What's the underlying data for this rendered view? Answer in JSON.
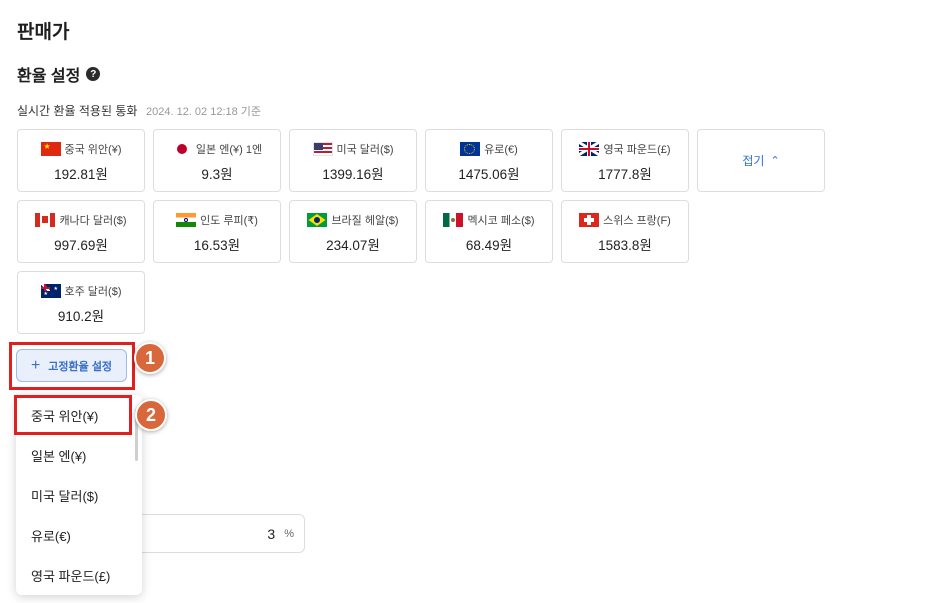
{
  "header": {
    "title": "판매가"
  },
  "exchange": {
    "title": "환율 설정",
    "help_icon": "question-circle-icon",
    "realtime_label": "실시간 환율 적용된 통화",
    "realtime_date": "2024. 12. 02 12:18 기준",
    "fold_label": "접기",
    "currencies": [
      {
        "label": "중국 위안(¥)",
        "value": "192.81원",
        "flag": "flag-china-icon"
      },
      {
        "label": "일본 엔(¥) 1엔",
        "value": "9.3원",
        "flag": "flag-japan-icon"
      },
      {
        "label": "미국 달러($)",
        "value": "1399.16원",
        "flag": "flag-usa-icon"
      },
      {
        "label": "유로(€)",
        "value": "1475.06원",
        "flag": "flag-eu-icon"
      },
      {
        "label": "영국 파운드(£)",
        "value": "1777.8원",
        "flag": "flag-uk-icon"
      },
      {
        "label": "캐나다 달러($)",
        "value": "997.69원",
        "flag": "flag-canada-icon"
      },
      {
        "label": "인도 루피(₹)",
        "value": "16.53원",
        "flag": "flag-india-icon"
      },
      {
        "label": "브라질 헤알($)",
        "value": "234.07원",
        "flag": "flag-brazil-icon"
      },
      {
        "label": "멕시코 페소($)",
        "value": "68.49원",
        "flag": "flag-mexico-icon"
      },
      {
        "label": "스위스 프랑(F)",
        "value": "1583.8원",
        "flag": "flag-switzerland-icon"
      },
      {
        "label": "호주 달러($)",
        "value": "910.2원",
        "flag": "flag-australia-icon"
      }
    ]
  },
  "fixed_rate": {
    "button_label": "고정환율 설정",
    "dropdown_options": [
      "중국 위안(¥)",
      "일본 엔(¥)",
      "미국 달러($)",
      "유로(€)",
      "영국 파운드(£)"
    ]
  },
  "margin_input": {
    "value": "3",
    "unit": "%"
  },
  "annotations": {
    "step1": "1",
    "step2": "2",
    "highlight_color": "#e02020",
    "badge_color": "#d9673c"
  },
  "colors": {
    "accent": "#2f6fd6",
    "button_bg": "#eaf0fb"
  }
}
